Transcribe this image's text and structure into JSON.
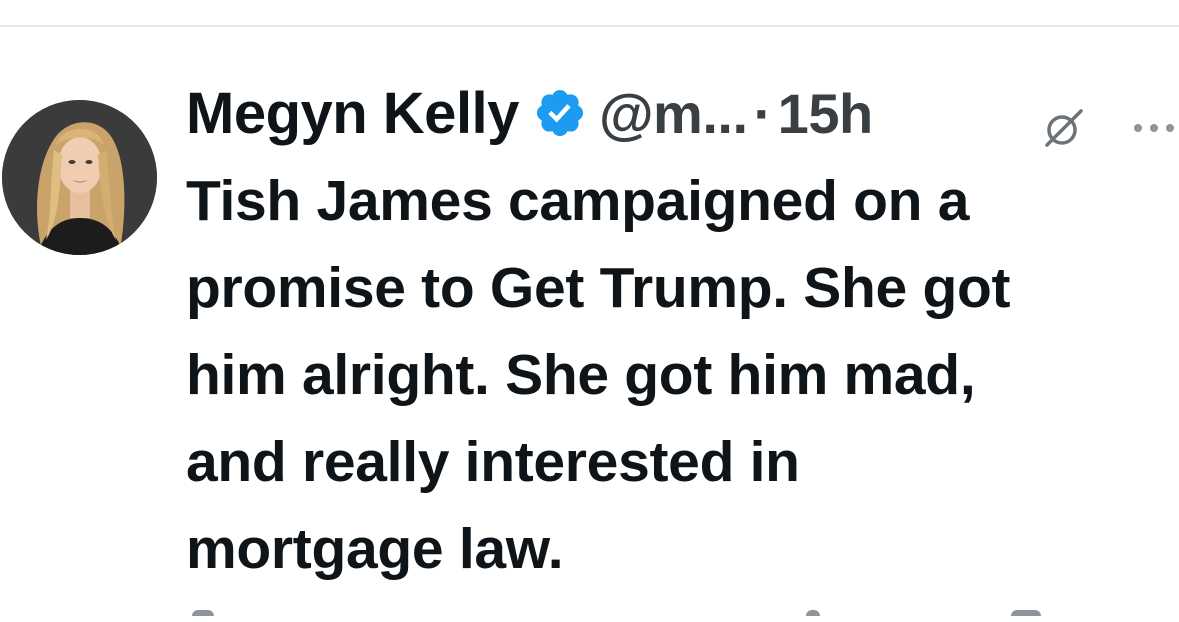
{
  "tweet": {
    "display_name": "Megyn Kelly",
    "handle": "@m...",
    "separator": "·",
    "timestamp": "15h",
    "text": "Tish James campaigned on a\npromise to Get Trump. She got\nhim alright. She got him mad,\nand really interested in\nmortgage law."
  },
  "icons": {
    "verified": "verified-badge-icon",
    "grok": "grok-icon",
    "more": "more-options-icon"
  },
  "colors": {
    "verified_blue": "#1d9bf0",
    "text": "#0f1419",
    "secondary": "#536471",
    "divider": "#e6e9eb"
  }
}
